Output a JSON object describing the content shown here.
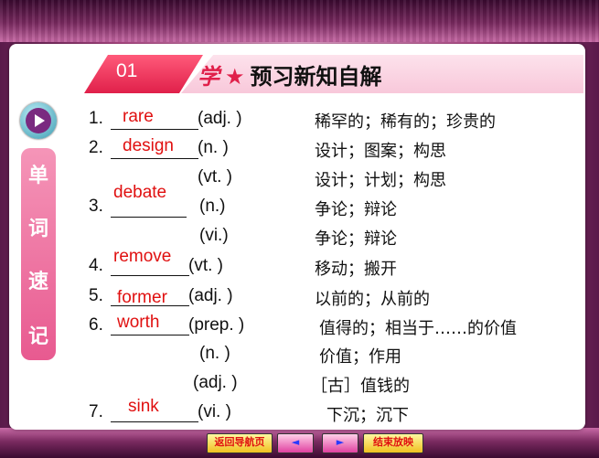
{
  "header": {
    "section_number": "01",
    "title_prefix": "学",
    "star": "★",
    "title": "预习新知自解"
  },
  "sidebar": {
    "chars": [
      "单",
      "词",
      "速",
      "记"
    ]
  },
  "rows": [
    {
      "num": "1.",
      "answer": "rare",
      "pos": "(adj. )",
      "meaning": "稀罕的；稀有的；珍贵的"
    },
    {
      "num": "2.",
      "answer": "design",
      "pos": "(n. )",
      "meaning": "设计；图案；构思"
    },
    {
      "num": "",
      "answer": "",
      "pos": "(vt. )",
      "meaning": "设计；计划；构思"
    },
    {
      "num": "3.",
      "answer": "debate",
      "pos": "(n.)",
      "meaning": "争论；辩论"
    },
    {
      "num": "",
      "answer": "",
      "pos": "(vi.)",
      "meaning": "争论；辩论"
    },
    {
      "num": "4.",
      "answer": "remove",
      "pos": "(vt. )",
      "meaning": "移动；搬开"
    },
    {
      "num": "5.",
      "answer": "former",
      "pos": "(adj. )",
      "meaning": "以前的；从前的"
    },
    {
      "num": "6.",
      "answer": "worth",
      "pos": "(prep. )",
      "meaning": "值得的；相当于……的价值"
    },
    {
      "num": "",
      "answer": "",
      "pos": "(n. )",
      "meaning": "价值；作用"
    },
    {
      "num": "",
      "answer": "",
      "pos": "(adj. )",
      "meaning": "［古］值钱的"
    },
    {
      "num": "7.",
      "answer": "sink",
      "pos": "(vi. )",
      "meaning": "下沉；沉下"
    }
  ],
  "footer": {
    "back_label": "返回导航页",
    "prev_label": "◄",
    "next_label": "►",
    "end_label": "结束放映"
  },
  "colors": {
    "accent": "#e01010",
    "pink": "#e85a90",
    "frame": "#b44a8a"
  }
}
